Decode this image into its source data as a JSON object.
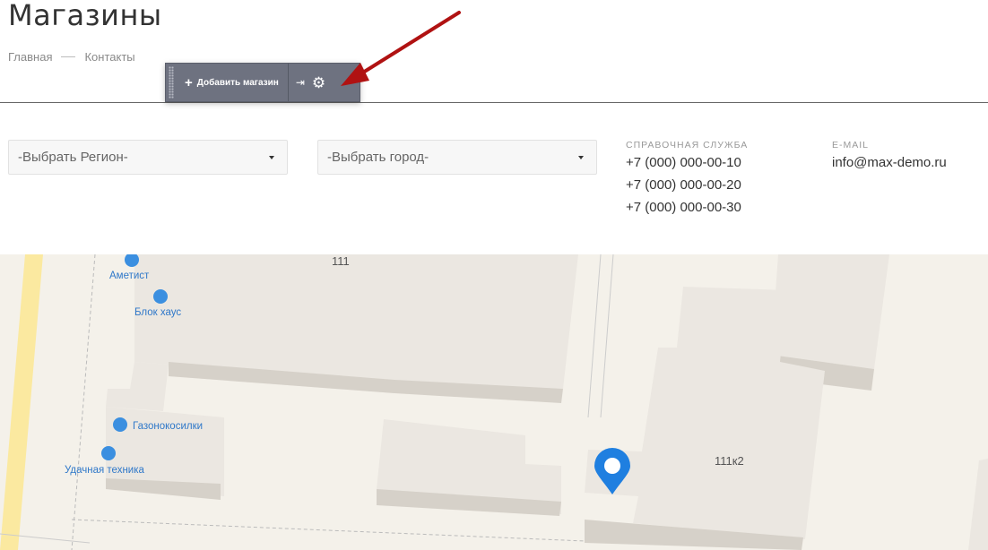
{
  "page": {
    "title": "Магазины"
  },
  "breadcrumb": [
    {
      "label": "Главная"
    },
    {
      "label": "Контакты"
    }
  ],
  "admin_toolbar": {
    "add_label": "Добавить магазин",
    "pin_icon": "pin-icon",
    "settings_icon": "gear-icon"
  },
  "filters": {
    "region": {
      "selected": "-Выбрать Регион-"
    },
    "city": {
      "selected": "-Выбрать город-"
    }
  },
  "contacts": {
    "phone_label": "СПРАВОЧНАЯ СЛУЖБА",
    "phones": [
      "+7 (000) 000-00-10",
      "+7 (000) 000-00-20",
      "+7 (000) 000-00-30"
    ],
    "email_label": "E-MAIL",
    "email": "info@max-demo.ru"
  },
  "map": {
    "building_labels": [
      "111",
      "111к2"
    ],
    "pois": [
      {
        "name": "Аметист",
        "icon": "store-icon"
      },
      {
        "name": "Блок хаус",
        "icon": "cart-icon"
      },
      {
        "name": "Газонокосилки",
        "icon": "garden-icon"
      },
      {
        "name": "Удачная техника",
        "icon": "garden-icon"
      }
    ],
    "colors": {
      "poi": "#3b8fe0",
      "marker": "#1f7fe0",
      "road": "#fbe9a0"
    }
  }
}
